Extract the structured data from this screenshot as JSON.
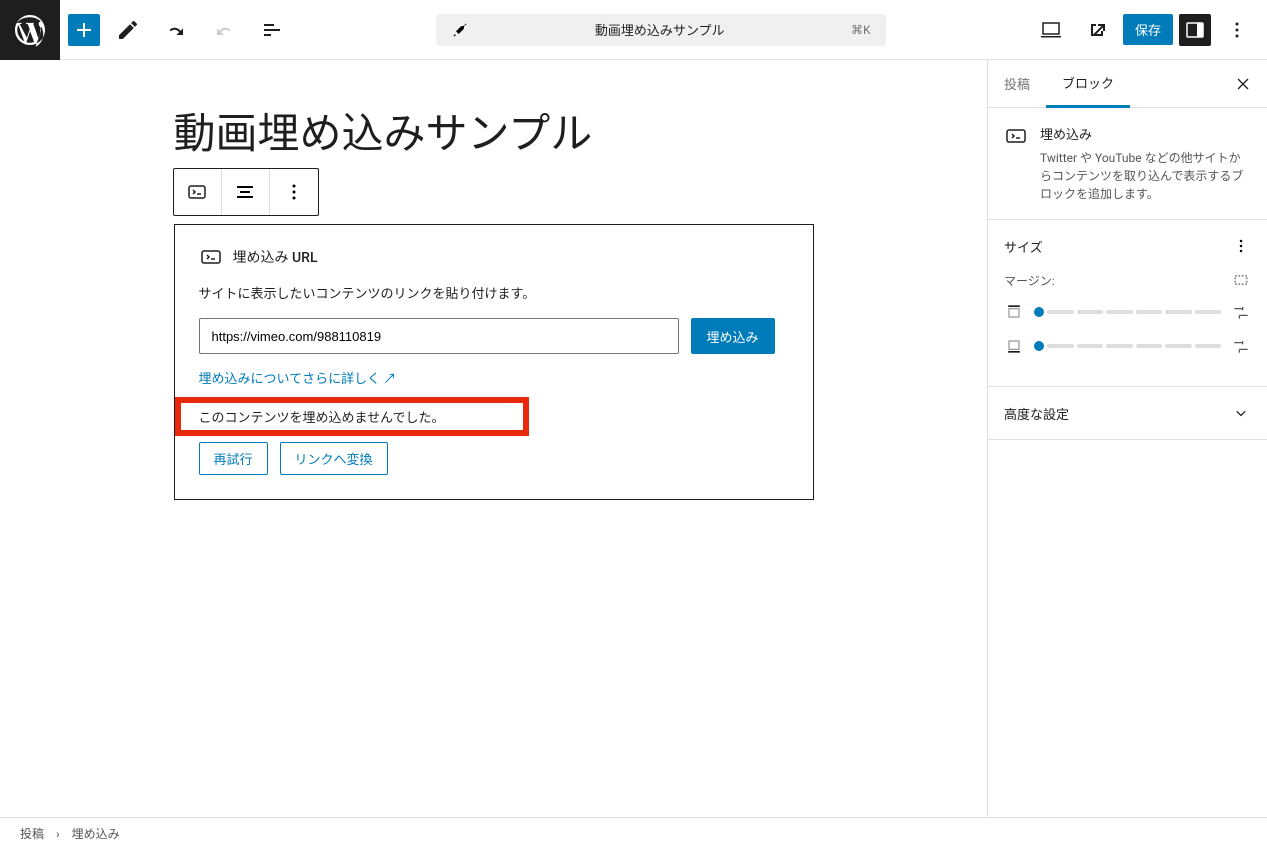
{
  "toolbar": {
    "document_title": "動画埋め込みサンプル",
    "shortcut": "⌘K",
    "save_label": "保存"
  },
  "editor": {
    "post_title": "動画埋め込みサンプル",
    "embed": {
      "header_title": "埋め込み URL",
      "instruction": "サイトに表示したいコンテンツのリンクを貼り付けます。",
      "url_value": "https://vimeo.com/988110819",
      "submit_label": "埋め込み",
      "learn_more": "埋め込みについてさらに詳しく ↗",
      "error_message": "このコンテンツを埋め込めませんでした。",
      "retry_label": "再試行",
      "convert_label": "リンクへ変換"
    }
  },
  "sidebar": {
    "tab_post": "投稿",
    "tab_block": "ブロック",
    "block_card": {
      "title": "埋め込み",
      "description": "Twitter や YouTube などの他サイトからコンテンツを取り込んで表示するブロックを追加します。"
    },
    "size_panel": {
      "title": "サイズ",
      "margin_label": "マージン:"
    },
    "advanced_panel": {
      "title": "高度な設定"
    }
  },
  "breadcrumb": {
    "root": "投稿",
    "current": "埋め込み"
  }
}
